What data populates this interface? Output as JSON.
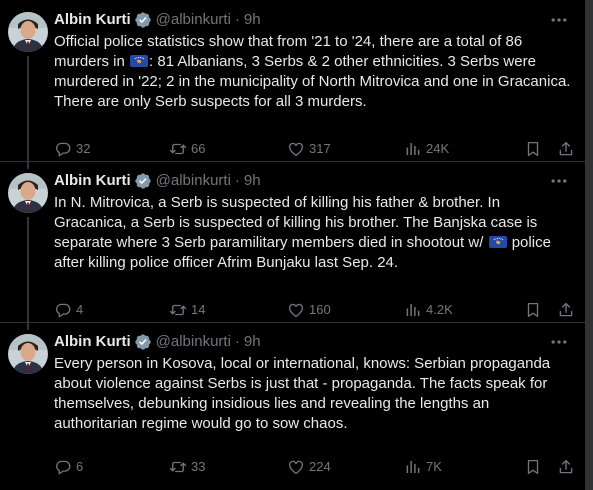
{
  "colors": {
    "background": "#000000",
    "text": "#e7e9ea",
    "muted": "#71767b",
    "verified": "#829aab",
    "divider": "#2f3336"
  },
  "icons": {
    "verified": "verified-badge-icon",
    "more": "more-icon",
    "reply": "reply-icon",
    "repost": "repost-icon",
    "like": "like-icon",
    "views": "views-icon",
    "bookmark": "bookmark-icon",
    "share": "share-icon",
    "flag": "kosovo-flag-icon"
  },
  "tweets": [
    {
      "author": "Albin Kurti",
      "handle": "@albinkurti",
      "time": "9h",
      "text_a": "Official police statistics show that from '21 to '24, there are a total of 86 murders in ",
      "text_b": ": 81 Albanians, 3 Serbs & 2 other ethnicities. 3 Serbs were murdered in '22; 2 in the municipality of North Mitrovica and one in Gracanica. There are only Serb suspects for all 3 murders.",
      "replies": "32",
      "reposts": "66",
      "likes": "317",
      "views": "24K"
    },
    {
      "author": "Albin Kurti",
      "handle": "@albinkurti",
      "time": "9h",
      "text_a": "In N. Mitrovica, a Serb is suspected of killing his father & brother. In Gracanica, a Serb is suspected of killing his brother. The Banjska case is separate where 3 Serb paramilitary members died in shootout w/ ",
      "text_b": " police after killing police officer Afrim Bunjaku last Sep. 24.",
      "replies": "4",
      "reposts": "14",
      "likes": "160",
      "views": "4.2K"
    },
    {
      "author": "Albin Kurti",
      "handle": "@albinkurti",
      "time": "9h",
      "text": "Every person in Kosova, local or international, knows: Serbian propaganda about violence against Serbs is just that - propaganda. The facts speak for themselves, debunking insidious lies and revealing the lengths an authoritarian regime would go to sow chaos.",
      "replies": "6",
      "reposts": "33",
      "likes": "224",
      "views": "7K"
    }
  ]
}
